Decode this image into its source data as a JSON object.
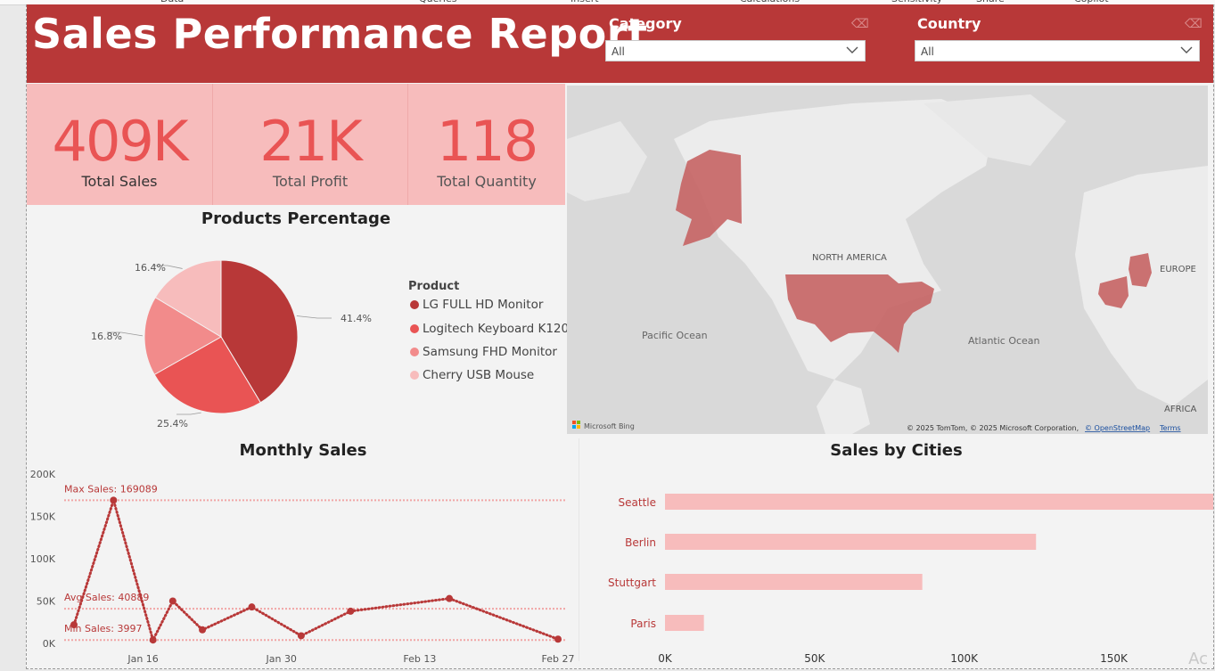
{
  "ribbon": {
    "items": [
      "Data",
      "Queries",
      "Insert",
      "Calculations",
      "Sensitivity",
      "Share",
      "Copilot"
    ]
  },
  "header": {
    "title": "Sales Performance Report"
  },
  "filters": [
    {
      "label": "Category",
      "value": "All"
    },
    {
      "label": "Country",
      "value": "All"
    }
  ],
  "kpis": [
    {
      "value": "409K",
      "label": "Total Sales"
    },
    {
      "value": "21K",
      "label": "Total Profit"
    },
    {
      "value": "118",
      "label": "Total Quantity"
    }
  ],
  "map": {
    "labels": {
      "north_america": "NORTH AMERICA",
      "europe": "EUROPE",
      "africa": "AFRICA",
      "pacific": "Pacific Ocean",
      "atlantic": "Atlantic Ocean"
    },
    "provider": "Microsoft Bing",
    "attribution": "© 2025 TomTom, © 2025 Microsoft Corporation,",
    "osm": "© OpenStreetMap",
    "terms": "Terms"
  },
  "products_chart_title": "Products Percentage",
  "monthly_chart_title": "Monthly Sales",
  "cities_chart_title": "Sales by Cities",
  "chart_data": [
    {
      "type": "pie",
      "title": "Products Percentage",
      "legend_title": "Product",
      "categories": [
        "LG FULL HD Monitor",
        "Logitech Keyboard K120",
        "Samsung FHD Monitor",
        "Cherry USB Mouse"
      ],
      "values": [
        41.4,
        25.4,
        16.8,
        16.4
      ],
      "value_labels": [
        "41.4%",
        "25.4%",
        "16.8%",
        "16.4%"
      ],
      "colors": [
        "#b83838",
        "#e95454",
        "#f28b8b",
        "#f7bcbc"
      ],
      "legend_position": "right"
    },
    {
      "type": "line",
      "title": "Monthly Sales",
      "x": [
        "Jan 9",
        "Jan 13",
        "Jan 17",
        "Jan 19",
        "Jan 22",
        "Jan 27",
        "Feb 1",
        "Feb 6",
        "Feb 16",
        "Feb 27"
      ],
      "y": [
        22000,
        169089,
        3997,
        50000,
        16000,
        43000,
        9000,
        38000,
        53000,
        5000
      ],
      "x_tick_labels": [
        "Jan 16",
        "Jan 30",
        "Feb 13",
        "Feb 27"
      ],
      "y_tick_labels": [
        "0K",
        "50K",
        "100K",
        "150K",
        "200K"
      ],
      "ylim": [
        0,
        200000
      ],
      "reference_lines": [
        {
          "label": "Max Sales: 169089",
          "value": 169089
        },
        {
          "label": "Avg Sales: 40889",
          "value": 40889
        },
        {
          "label": "Min Sales: 3997",
          "value": 3997
        }
      ],
      "color": "#b83838"
    },
    {
      "type": "bar",
      "orientation": "horizontal",
      "title": "Sales by Cities",
      "categories": [
        "Seattle",
        "Berlin",
        "Stuttgart",
        "Paris"
      ],
      "values": [
        184000,
        124000,
        86000,
        13000
      ],
      "x_tick_labels": [
        "0K",
        "50K",
        "100K",
        "150K"
      ],
      "xlim": [
        0,
        185000
      ],
      "color": "#f7bcbc"
    }
  ]
}
